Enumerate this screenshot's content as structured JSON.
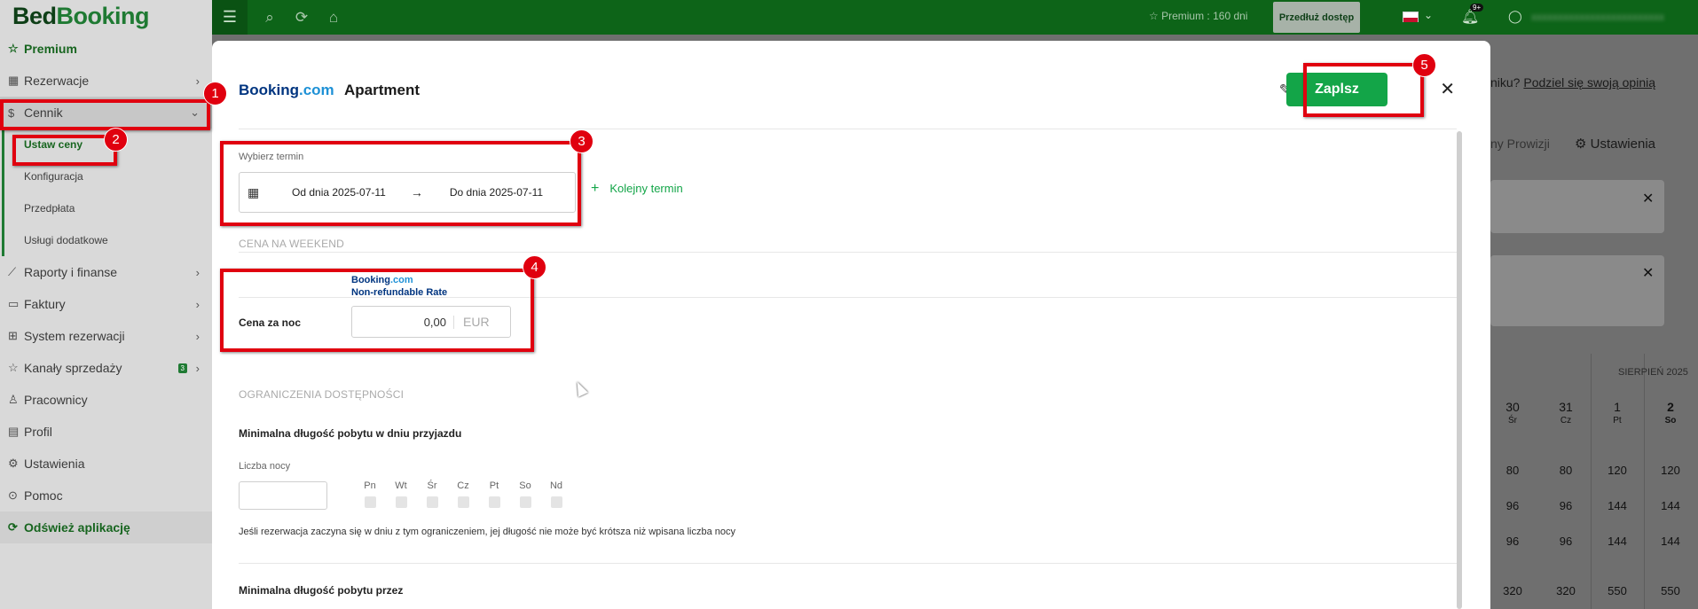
{
  "logo": {
    "bed": "Bed",
    "booking": "Booking"
  },
  "sidebar": {
    "premium": "Premium",
    "items": [
      {
        "label": "Rezerwacje"
      },
      {
        "label": "Cennik"
      },
      {
        "label": "Raporty i finanse"
      },
      {
        "label": "Faktury"
      },
      {
        "label": "System rezerwacji"
      },
      {
        "label": "Kanały sprzedaży",
        "badge": "3"
      },
      {
        "label": "Pracownicy"
      },
      {
        "label": "Profil"
      },
      {
        "label": "Ustawienia"
      },
      {
        "label": "Pomoc"
      }
    ],
    "submenu": [
      "Ustaw ceny",
      "Konfiguracja",
      "Przedpłata",
      "Usługi dodatkowe"
    ],
    "refresh": "Odśwież aplikację"
  },
  "topbar": {
    "premium_info": "Premium : 160 dni",
    "extend_label": "Przedłuż dostęp",
    "notif_badge": "9+",
    "user_name": "xxxxxxxxxxxxxxxxxxxxxxxxx"
  },
  "background": {
    "feedback_text": "niku? ",
    "feedback_link": "Podziel się swoją opinią",
    "tab_commission": "ny Prowizji",
    "tab_settings": "Ustawienia",
    "month_label": "SIERPIEŃ 2025",
    "days": [
      {
        "num": "30",
        "day": "Śr"
      },
      {
        "num": "31",
        "day": "Cz"
      },
      {
        "num": "1",
        "day": "Pt"
      },
      {
        "num": "2",
        "day": "So"
      }
    ],
    "rows": [
      [
        "80",
        "80",
        "120",
        "120"
      ],
      [
        "96",
        "96",
        "144",
        "144"
      ],
      [
        "96",
        "96",
        "144",
        "144"
      ],
      [
        "320",
        "320",
        "550",
        "550"
      ]
    ]
  },
  "modal": {
    "brand_main": "Booking",
    "brand_suffix": ".com",
    "title": "Apartment",
    "save_label": "Zaplsz",
    "date_section": {
      "label": "Wybierz termin",
      "from": "Od dnia 2025-07-11",
      "to": "Do dnia 2025-07-11",
      "next_term": "Kolejny termin"
    },
    "weekend_label": "CENA NA WEEKEND",
    "rate": {
      "brand_main": "Booking",
      "brand_suffix": ".com",
      "rate_name": "Non-refundable Rate",
      "price_label": "Cena za noc",
      "price_value": "0,00",
      "currency": "EUR"
    },
    "restrictions_label": "OGRANICZENIA DOSTĘPNOŚCI",
    "min_stay_arrival": "Minimalna długość pobytu w dniu przyjazdu",
    "nights_label": "Liczba nocy",
    "days": [
      "Pn",
      "Wt",
      "Śr",
      "Cz",
      "Pt",
      "So",
      "Nd"
    ],
    "note": "Jeśli rezerwacja zaczyna się w dniu z tym ograniczeniem, jej długość nie może być krótsza niż wpisana liczba nocy",
    "min_stay_through": "Minimalna długość pobytu przez"
  },
  "annotations": [
    "1",
    "2",
    "3",
    "4",
    "5"
  ]
}
